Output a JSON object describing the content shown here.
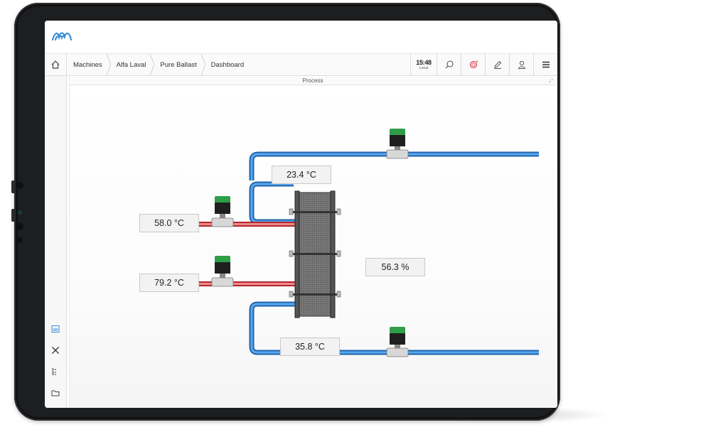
{
  "breadcrumb": [
    "Machines",
    "Alfa Laval",
    "Pure Ballast",
    "Dashboard"
  ],
  "clock": {
    "time": "15:48",
    "zone": "Local"
  },
  "panel": {
    "title": "Process"
  },
  "readouts": {
    "cold_out_temp": "23.4 °C",
    "hot_in_temp_1": "58.0 °C",
    "hot_in_temp_2": "79.2 °C",
    "valve_open": "56.3 %",
    "cold_in_temp": "35.8 °C"
  },
  "icons": {
    "logo": "alfa-laval-wave-logo",
    "home": "home-icon",
    "tools": [
      "clock-icon",
      "search-icon",
      "alarm-icon",
      "edit-icon",
      "user-icon",
      "menu-icon"
    ],
    "rail": [
      "dashboard-icon",
      "tools-icon",
      "tree-icon",
      "folder-icon",
      "people-icon"
    ]
  },
  "colors": {
    "hot_pipe": "#e2474b",
    "cold_pipe": "#2f85d6",
    "accent": "#3a8fd8",
    "valve_cap": "#2e9e48"
  }
}
